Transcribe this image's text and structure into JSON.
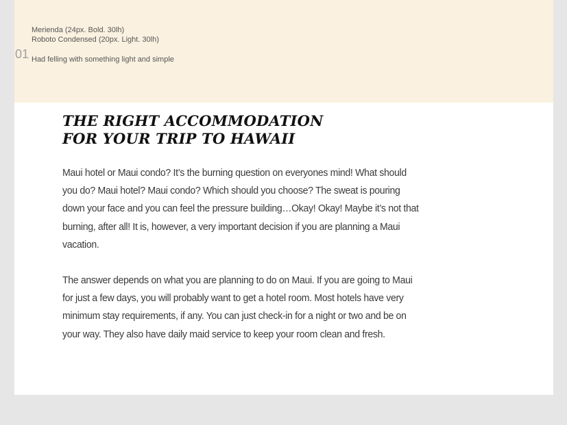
{
  "spec_panel": {
    "number": "01",
    "heading_font_spec": "Merienda (24px. Bold. 30lh)",
    "body_font_spec": "Roboto Condensed (20px. Light. 30lh)",
    "description": "Had felling with something light and simple"
  },
  "article": {
    "headline_line_1": "THE RIGHT ACCOMMODATION",
    "headline_line_2": "FOR YOUR TRIP TO HAWAII",
    "paragraphs": [
      "Maui hotel or Maui condo? It’s the burning question on everyones mind! What should you do? Maui hotel? Maui condo? Which should you choose? The sweat is pouring down your face and you can feel the pressure building…Okay! Okay! Maybe it’s not that burning, after all! It is, however, a very important decision if you are planning a Maui vacation.",
      "The answer depends on what you are planning to do on Maui. If you are going to Maui for just a few days, you will probably want to get a hotel room. Most hotels have very minimum stay requirements, if any. You can just check-in for a night or two and be on your way. They also have daily maid service to keep your room clean and fresh."
    ]
  },
  "colors": {
    "page_background": "#e6e6e6",
    "card_background": "#ffffff",
    "spec_panel_background": "#faf1e0",
    "headline_text": "#111111",
    "body_text": "#3a3a3a"
  }
}
